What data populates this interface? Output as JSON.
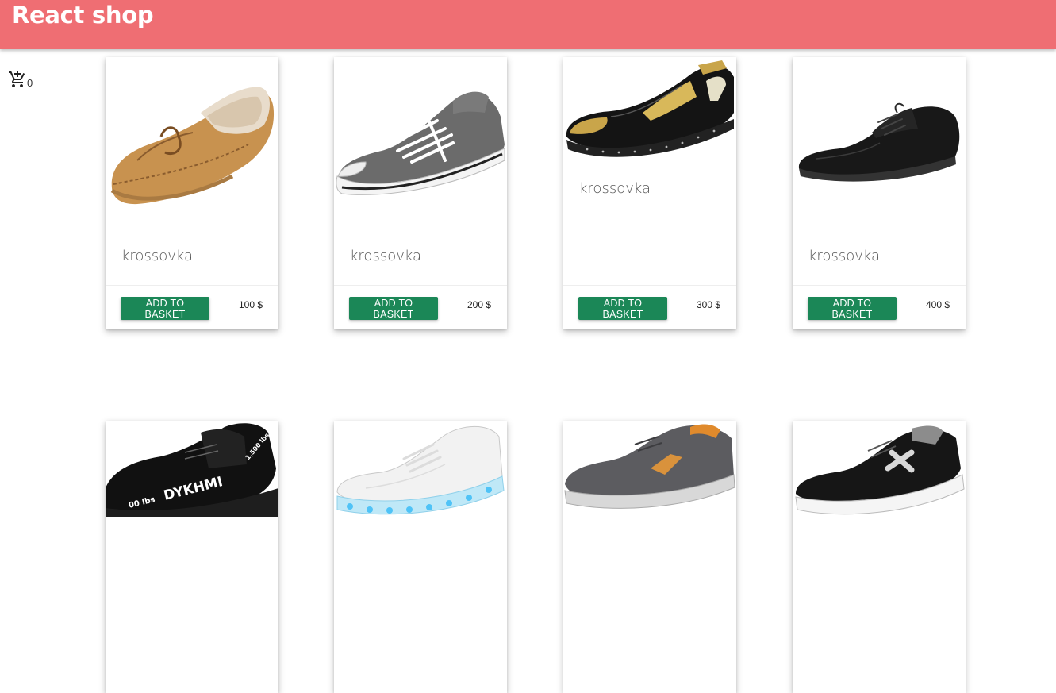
{
  "header": {
    "title": "React shop"
  },
  "cart": {
    "count": "0",
    "icon": "cart-plus-icon"
  },
  "products": [
    {
      "title": "krossovka",
      "button": "ADD TO BASKET",
      "price": "100 $",
      "image": "moccasin-shoe"
    },
    {
      "title": "krossovka",
      "button": "ADD TO BASKET",
      "price": "200 $",
      "image": "grey-sneaker"
    },
    {
      "title": "krossovka",
      "button": "ADD TO BASKET",
      "price": "300 $",
      "image": "patent-loafer"
    },
    {
      "title": "krossovka",
      "button": "ADD TO BASKET",
      "price": "400 $",
      "image": "black-derby"
    },
    {
      "image": "black-running-shoe"
    },
    {
      "image": "white-led-sneaker"
    },
    {
      "image": "grey-skechers-sneaker"
    },
    {
      "image": "black-white-sneaker"
    }
  ],
  "colors": {
    "header": "#ef6e73",
    "button": "#1b8757"
  }
}
